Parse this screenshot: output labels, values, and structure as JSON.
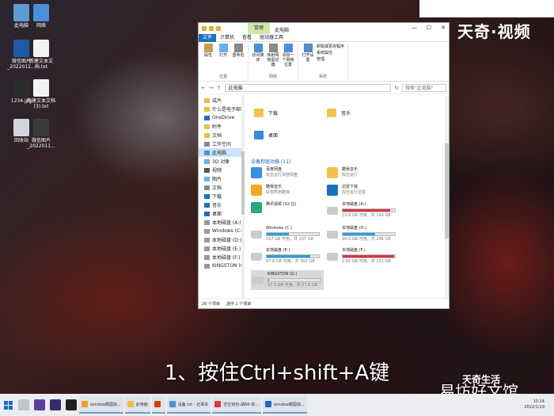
{
  "desktop": {
    "icons": [
      {
        "label": "此电脑",
        "color": "#5b9bd5"
      },
      {
        "label": "网络",
        "color": "#4a90d9"
      },
      {
        "label": "微信图片\n_2022011...",
        "color": "#1e5aa8"
      },
      {
        "label": "新建文本文\n档.txt",
        "color": "#f2f2f2"
      },
      {
        "label": "1234.jpg",
        "color": "#2b2b2b"
      },
      {
        "label": "新建文本文档\n(3).txt",
        "color": "#f2f2f2"
      },
      {
        "label": "回收站",
        "color": "#cfd8e0"
      },
      {
        "label": "微信图片\n_2022011...",
        "color": "#3a3a3a"
      }
    ]
  },
  "watermark": "天奇·视频",
  "caption": "1、按住Ctrl+shift+A键",
  "brand": "天奇生活",
  "brand2": "易坊好文馆",
  "explorer": {
    "tab_manage": "管理",
    "title": "此电脑",
    "ribbon_tabs": [
      "文件",
      "计算机",
      "查看",
      "驱动器工具"
    ],
    "ribbon": {
      "location": {
        "buttons": [
          "属性",
          "打开",
          "重命名"
        ],
        "label": "位置"
      },
      "network": {
        "buttons": [
          "访问媒体",
          "映射网络驱动器",
          "添加一个网络位置"
        ],
        "label": "网络"
      },
      "system": {
        "buttons": [
          "打开设置"
        ],
        "small": [
          "卸载或更改程序",
          "系统属性",
          "管理"
        ],
        "label": "系统"
      }
    },
    "address": "此电脑",
    "search_placeholder": "搜索\"此电脑\"",
    "nav_items": [
      {
        "label": "成片",
        "icon": "#e8c040"
      },
      {
        "label": "什么是电子邮箱",
        "icon": "#e8c040"
      },
      {
        "label": "OneDrive",
        "icon": "#1a6fc2"
      },
      {
        "label": "附件",
        "icon": "#e8c040"
      },
      {
        "label": "文档",
        "icon": "#e8c040"
      },
      {
        "label": "工作空间",
        "icon": "#888888"
      },
      {
        "label": "此电脑",
        "icon": "#4a90d9",
        "selected": true
      },
      {
        "label": "3D 对象",
        "icon": "#6ab0e8"
      },
      {
        "label": "视频",
        "icon": "#555555"
      },
      {
        "label": "图片",
        "icon": "#6ab0e8"
      },
      {
        "label": "文档",
        "icon": "#888888"
      },
      {
        "label": "下载",
        "icon": "#1a6fc2"
      },
      {
        "label": "音乐",
        "icon": "#1a6fc2"
      },
      {
        "label": "桌面",
        "icon": "#1a6fc2"
      },
      {
        "label": "本地磁盘 (A:)",
        "icon": "#999999"
      },
      {
        "label": "Windows (C:)",
        "icon": "#999999"
      },
      {
        "label": "本地磁盘 (D:)",
        "icon": "#999999"
      },
      {
        "label": "本地磁盘 (E:)",
        "icon": "#999999"
      },
      {
        "label": "本地磁盘 (F:)",
        "icon": "#999999"
      },
      {
        "label": "KINGSTON (G:)",
        "icon": "#999999"
      }
    ],
    "folders": [
      "下载",
      "音乐",
      "桌面"
    ],
    "section_title": "设备和驱动器 (11)",
    "devices": [
      {
        "name": "百度网盘",
        "sub": "双击运行百度网盘",
        "color": "#3b8fe0"
      },
      {
        "name": "酷我音乐",
        "sub": "双击运行",
        "color": "#f0c44c"
      },
      {
        "name": "酷我音乐",
        "sub": "好音质用酷我",
        "color": "#f5a623"
      },
      {
        "name": "迅雷下载",
        "sub": "双击运行迅雷",
        "color": "#1a6fc2"
      },
      {
        "name": "腾讯视频 (32 位)",
        "sub": "",
        "color": "#2aa876"
      }
    ],
    "drives": [
      {
        "name": "本地磁盘 (A:)",
        "free": "13.9 GB 可用，共 149 GB",
        "used": 0.91,
        "color": "#d9363e"
      },
      {
        "name": "Windows (C:)",
        "free": "137 GB 可用，共 237 GB",
        "used": 0.42,
        "color": "#26a0da"
      },
      {
        "name": "本地磁盘 (D:)",
        "free": "94.6 GB 可用，共 246 GB",
        "used": 0.62,
        "color": "#26a0da"
      },
      {
        "name": "本地磁盘 (E:)",
        "free": "47.8 GB 可用，共 302 GB",
        "used": 0.84,
        "color": "#26a0da"
      },
      {
        "name": "本地磁盘 (F:)",
        "free": "2.65 GB 可用，共 232 GB",
        "used": 0.99,
        "color": "#d9363e"
      },
      {
        "name": "KINGSTON (G:)",
        "free": "57.5 GB 可用，共 57.6 GB",
        "used": 0.01,
        "color": "#26a0da"
      }
    ],
    "status": {
      "count": "20 个项目",
      "selected": "选中 1 个项目"
    }
  },
  "taskbar": {
    "tasks": [
      {
        "label": "window截图快...",
        "color": "#e8a030"
      },
      {
        "label": "此电脑",
        "color": "#e8c040"
      },
      {
        "label": "",
        "color": "#d83b01"
      },
      {
        "label": "设备.txt - 记事本",
        "color": "#4a90d9"
      },
      {
        "label": "空空如也-胡66-单...",
        "color": "#d9363e"
      },
      {
        "label": "window截图快...",
        "color": "#1a6fc2"
      }
    ],
    "time": "10:24",
    "date": "2022/1/19"
  }
}
